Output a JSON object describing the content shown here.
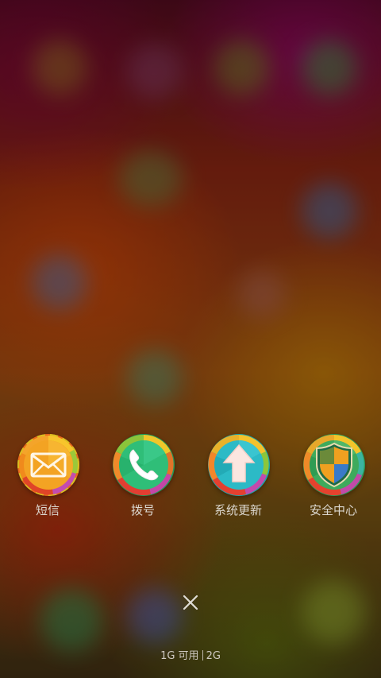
{
  "share_targets": [
    {
      "label": "短信",
      "icon": "envelope-icon",
      "color": "#f2a21c"
    },
    {
      "label": "拨号",
      "icon": "phone-icon",
      "color": "#2dbb72"
    },
    {
      "label": "系统更新",
      "icon": "upload-arrow-icon",
      "color": "#27b9c4"
    },
    {
      "label": "安全中心",
      "icon": "shield-icon",
      "color": "#c9a226"
    }
  ],
  "close": {
    "icon": "close-icon"
  },
  "storage": {
    "available": "1G 可用",
    "total": "2G"
  }
}
